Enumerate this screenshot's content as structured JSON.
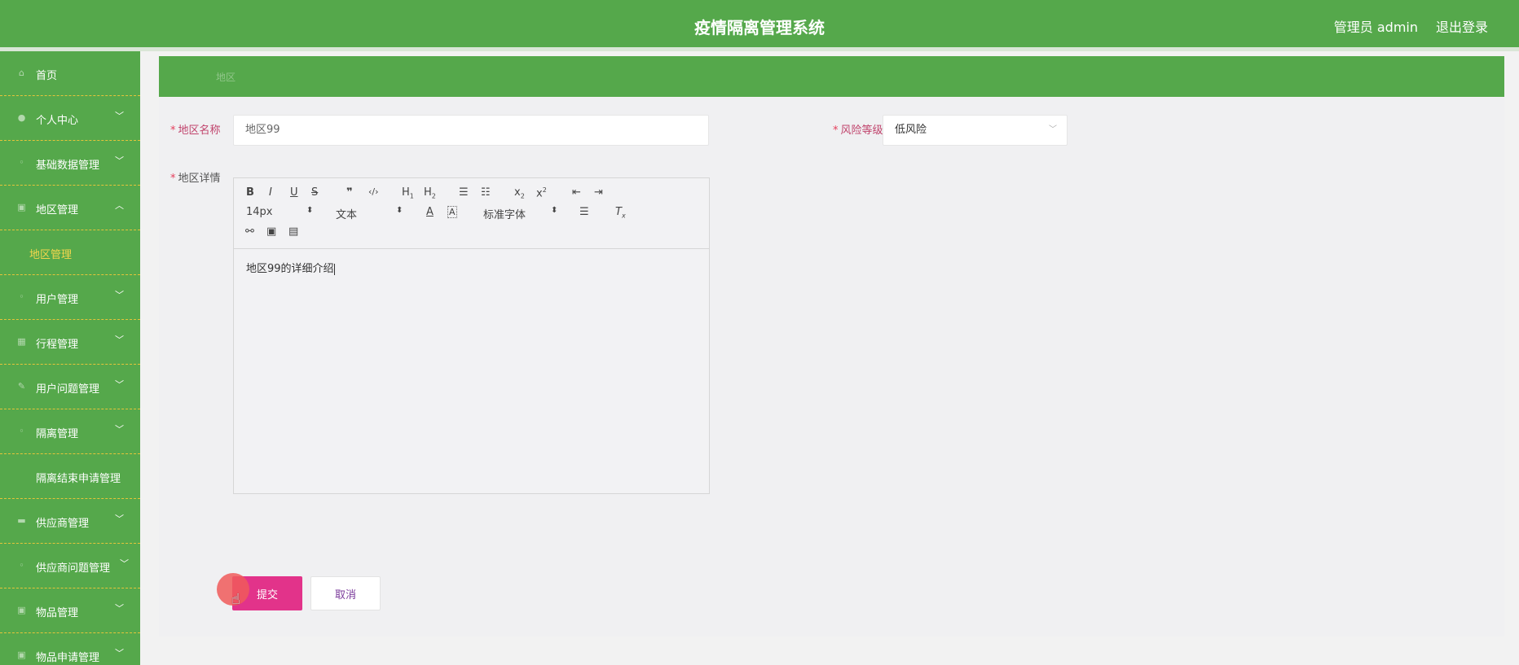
{
  "header": {
    "title": "疫情隔离管理系统",
    "user_label": "管理员 admin",
    "logout_label": "退出登录"
  },
  "sidebar": {
    "items": [
      {
        "label": "首页",
        "icon": "home-icon",
        "chevron": false
      },
      {
        "label": "个人中心",
        "icon": "user-icon",
        "chevron": true
      },
      {
        "label": "基础数据管理",
        "icon": "data-icon",
        "chevron": true
      },
      {
        "label": "地区管理",
        "icon": "region-icon",
        "chevron": true,
        "expanded": true
      },
      {
        "label": "地区管理",
        "submenu": true,
        "active": true
      },
      {
        "label": "用户管理",
        "icon": "users-icon",
        "chevron": true
      },
      {
        "label": "行程管理",
        "icon": "trip-icon",
        "chevron": true
      },
      {
        "label": "用户问题管理",
        "icon": "question-icon",
        "chevron": true
      },
      {
        "label": "隔离管理",
        "icon": "isolation-icon",
        "chevron": true
      },
      {
        "label": "隔离结束申请管理",
        "icon": "",
        "chevron": false
      },
      {
        "label": "供应商管理",
        "icon": "supplier-icon",
        "chevron": true
      },
      {
        "label": "供应商问题管理",
        "icon": "supplier-question-icon",
        "chevron": true
      },
      {
        "label": "物品管理",
        "icon": "goods-icon",
        "chevron": true
      },
      {
        "label": "物品申请管理",
        "icon": "apply-icon",
        "chevron": true
      }
    ]
  },
  "breadcrumb": {
    "current": "地区"
  },
  "form": {
    "region_name_label": "地区名称",
    "region_name_value": "地区99",
    "risk_label": "风险等级",
    "risk_value": "低风险",
    "detail_label": "地区详情",
    "editor": {
      "font_size": "14px",
      "text_style": "文本",
      "font_family": "标准字体",
      "content": "地区99的详细介绍"
    },
    "submit_label": "提交",
    "cancel_label": "取消"
  },
  "colors": {
    "header_green": "#55a84b",
    "submit_pink": "#e2338a",
    "active_menu_yellow": "#f3d64d"
  }
}
